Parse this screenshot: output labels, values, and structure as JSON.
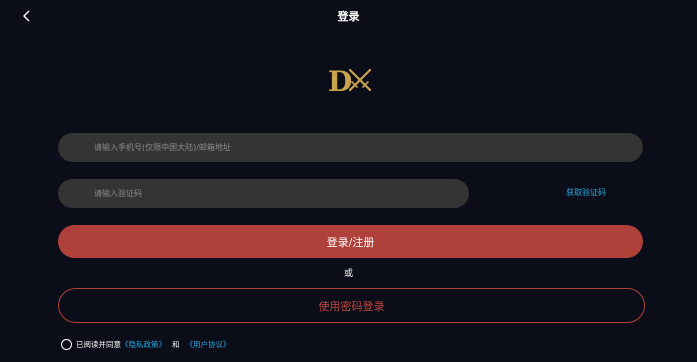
{
  "header": {
    "back_icon": "chevron-left-icon",
    "title": "登录"
  },
  "logo": {
    "letter": "D",
    "icon": "crossed-swords-icon",
    "colors": {
      "gold": "#c9a44e"
    }
  },
  "form": {
    "phone_placeholder": "请输入手机号(仅限中国大陆)/邮箱地址",
    "code_placeholder": "请输入验证码",
    "get_code_label": "获取验证码",
    "login_label": "登录/注册",
    "or_label": "或",
    "password_login_label": "使用密码登录"
  },
  "agreement": {
    "prefix": "已阅读并同意",
    "privacy_link": "《隐私政策》",
    "and": "和",
    "user_link": "《用户协议》"
  },
  "colors": {
    "background": "#0b0e18",
    "accent_red": "#b0403a",
    "link_blue": "#2aa6dc",
    "field_bg": "#343434"
  }
}
